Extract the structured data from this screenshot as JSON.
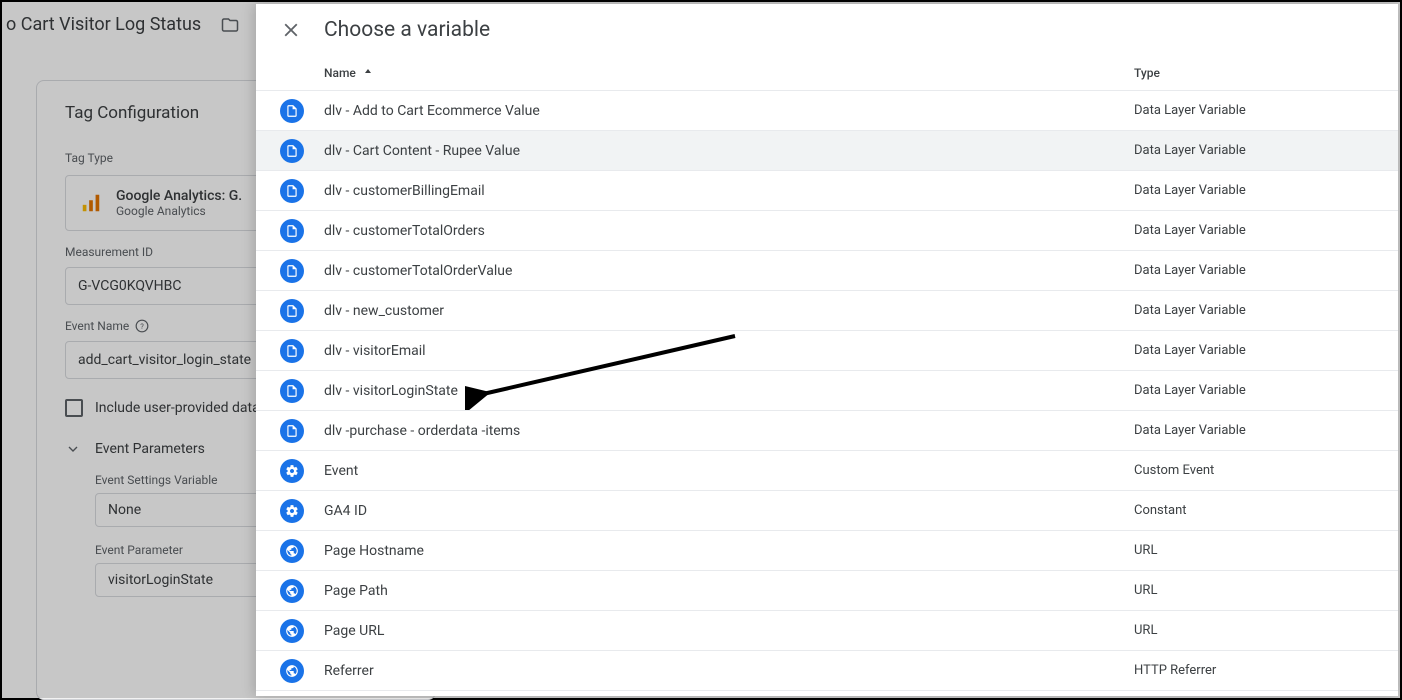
{
  "header": {
    "title": "o Cart Visitor Log Status"
  },
  "tag_configuration": {
    "title": "Tag Configuration",
    "type_label": "Tag Type",
    "type_name": "Google Analytics: G.",
    "type_sub": "Google Analytics",
    "measurement_id_label": "Measurement ID",
    "measurement_id_value": "G-VCG0KQVHBC",
    "event_name_label": "Event Name",
    "event_name_value": "add_cart_visitor_login_state",
    "include_upd_label": "Include user-provided data",
    "event_parameters_label": "Event Parameters",
    "event_settings_var_label": "Event Settings Variable",
    "event_settings_var_value": "None",
    "event_parameter_label": "Event Parameter",
    "event_parameter_value": "visitorLoginState"
  },
  "modal": {
    "title": "Choose a variable",
    "columns": {
      "name": "Name",
      "type": "Type"
    }
  },
  "variables": [
    {
      "icon": "page",
      "name": "dlv - Add to Cart Ecommerce Value",
      "type": "Data Layer Variable"
    },
    {
      "icon": "page",
      "name": "dlv - Cart Content - Rupee Value",
      "type": "Data Layer Variable",
      "hover": true
    },
    {
      "icon": "page",
      "name": "dlv - customerBillingEmail",
      "type": "Data Layer Variable"
    },
    {
      "icon": "page",
      "name": "dlv - customerTotalOrders",
      "type": "Data Layer Variable"
    },
    {
      "icon": "page",
      "name": "dlv - customerTotalOrderValue",
      "type": "Data Layer Variable"
    },
    {
      "icon": "page",
      "name": "dlv - new_customer",
      "type": "Data Layer Variable"
    },
    {
      "icon": "page",
      "name": "dlv - visitorEmail",
      "type": "Data Layer Variable"
    },
    {
      "icon": "page",
      "name": "dlv - visitorLoginState",
      "type": "Data Layer Variable"
    },
    {
      "icon": "page",
      "name": "dlv -purchase - orderdata -items",
      "type": "Data Layer Variable"
    },
    {
      "icon": "gear",
      "name": "Event",
      "type": "Custom Event"
    },
    {
      "icon": "gear",
      "name": "GA4 ID",
      "type": "Constant"
    },
    {
      "icon": "globe",
      "name": "Page Hostname",
      "type": "URL"
    },
    {
      "icon": "globe",
      "name": "Page Path",
      "type": "URL"
    },
    {
      "icon": "globe",
      "name": "Page URL",
      "type": "URL"
    },
    {
      "icon": "globe",
      "name": "Referrer",
      "type": "HTTP Referrer"
    }
  ]
}
